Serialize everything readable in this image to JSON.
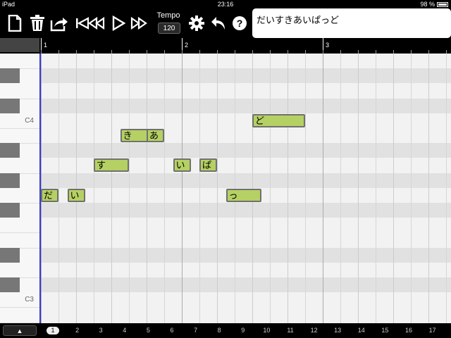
{
  "status": {
    "device": "iPad",
    "time": "23:16",
    "battery": "98 %"
  },
  "toolbar": {
    "icons": [
      "new-file-icon",
      "trash-icon",
      "share-icon",
      "skip-back-icon",
      "rewind-icon",
      "play-icon",
      "fast-forward-icon",
      "settings-icon",
      "undo-icon",
      "help-icon"
    ],
    "tempo_label": "Tempo",
    "tempo_value": "120"
  },
  "lyrics": {
    "text": "だいすきあいぱっど"
  },
  "ruler": {
    "bars": [
      "1",
      "2",
      "3"
    ]
  },
  "keyboard": {
    "labels": [
      "C4",
      "C3"
    ]
  },
  "notes": [
    {
      "text": "だ",
      "pitch": "G3",
      "start_beat": 0.0,
      "length_beats": 0.5
    },
    {
      "text": "い",
      "pitch": "G3",
      "start_beat": 0.75,
      "length_beats": 0.5
    },
    {
      "text": "す",
      "pitch": "A3",
      "start_beat": 1.5,
      "length_beats": 1.0
    },
    {
      "text": "き",
      "pitch": "B3",
      "start_beat": 2.25,
      "length_beats": 1.0
    },
    {
      "text": "あ",
      "pitch": "B3",
      "start_beat": 3.0,
      "length_beats": 0.5
    },
    {
      "text": "い",
      "pitch": "A3",
      "start_beat": 3.75,
      "length_beats": 0.5
    },
    {
      "text": "ぱ",
      "pitch": "A3",
      "start_beat": 4.5,
      "length_beats": 0.5
    },
    {
      "text": "っ",
      "pitch": "G3",
      "start_beat": 5.25,
      "length_beats": 1.0
    },
    {
      "text": "ど",
      "pitch": "C4",
      "start_beat": 6.0,
      "length_beats": 1.5
    }
  ],
  "pages": {
    "current": "1",
    "numbers": [
      "1",
      "2",
      "3",
      "4",
      "5",
      "6",
      "7",
      "8",
      "9",
      "10",
      "11",
      "12",
      "13",
      "14",
      "15",
      "16",
      "17"
    ]
  },
  "bottom": {
    "up_label": "▲"
  },
  "colors": {
    "note_fill": "#b5d063",
    "note_border": "#707070",
    "playhead": "#3a3ad6",
    "background": "#000000"
  }
}
